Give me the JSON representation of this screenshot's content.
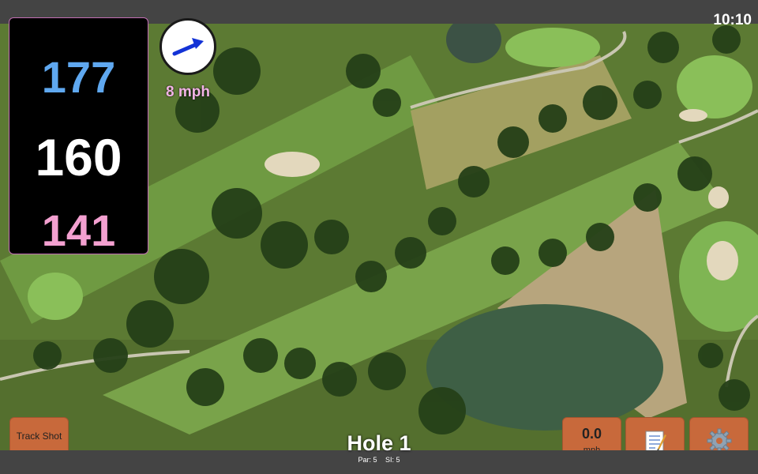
{
  "status": {
    "time": "10:10"
  },
  "yardage": {
    "back": "177",
    "middle": "160",
    "front": "141"
  },
  "wind": {
    "speed": "8 mph",
    "icon": "wind-arrow-icon"
  },
  "hole": {
    "title": "Hole 1",
    "par": "Par: 5",
    "si": "SI: 5"
  },
  "buttons": {
    "track_shot": "Track Shot",
    "speed_value": "0.0",
    "speed_unit": "mph",
    "notes_icon": "notepad-icon",
    "settings_icon": "gear-icon"
  },
  "colors": {
    "back_distance": "#5fa8f0",
    "middle_distance": "#ffffff",
    "front_distance": "#f3a0d0",
    "button": "#c8693b",
    "wind_text": "#f2b4e6"
  }
}
